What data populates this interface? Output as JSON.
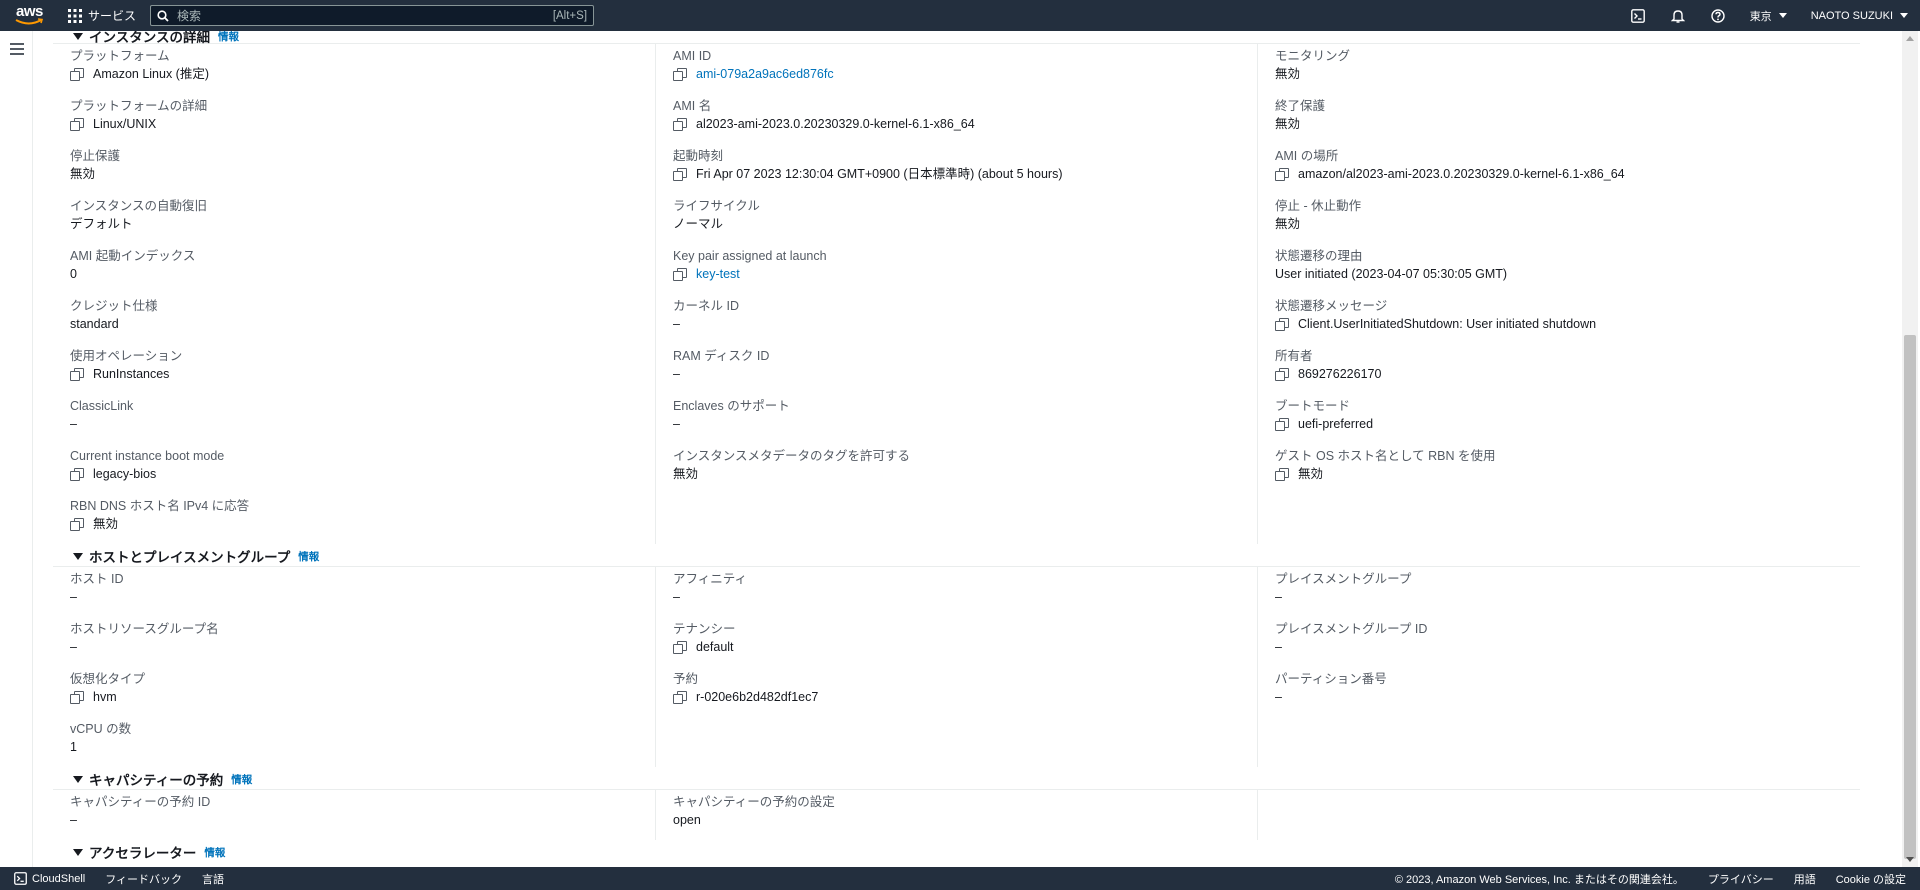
{
  "topbar": {
    "logo_text": "aws",
    "services_label": "サービス",
    "search_placeholder": "検索",
    "search_shortcut": "[Alt+S]",
    "region": "東京",
    "user": "NAOTO SUZUKI"
  },
  "sections": {
    "details": {
      "title": "インスタンスの詳細",
      "info": "情報",
      "col1": [
        {
          "label": "プラットフォーム",
          "value": "Amazon Linux (推定)"
        },
        {
          "label": "プラットフォームの詳細",
          "value": "Linux/UNIX"
        },
        {
          "label": "停止保護",
          "value": "無効"
        },
        {
          "label": "インスタンスの自動復旧",
          "value": "デフォルト"
        },
        {
          "label": "AMI 起動インデックス",
          "value": "0"
        },
        {
          "label": "クレジット仕様",
          "value": "standard"
        },
        {
          "label": "使用オペレーション",
          "value": "RunInstances"
        },
        {
          "label": "ClassicLink",
          "value": "–"
        },
        {
          "label": "Current instance boot mode",
          "value": "legacy-bios"
        },
        {
          "label": "RBN DNS ホスト名 IPv4 に応答",
          "value": "無効"
        }
      ],
      "col2": [
        {
          "label": "AMI ID",
          "value": "ami-079a2a9ac6ed876fc"
        },
        {
          "label": "AMI 名",
          "value": "al2023-ami-2023.0.20230329.0-kernel-6.1-x86_64"
        },
        {
          "label": "起動時刻",
          "value": "Fri Apr 07 2023 12:30:04 GMT+0900 (日本標準時) (about 5 hours)"
        },
        {
          "label": "ライフサイクル",
          "value": "ノーマル"
        },
        {
          "label": "Key pair assigned at launch",
          "value": "key-test"
        },
        {
          "label": "カーネル ID",
          "value": "–"
        },
        {
          "label": "RAM ディスク ID",
          "value": "–"
        },
        {
          "label": "Enclaves のサポート",
          "value": "–"
        },
        {
          "label": "インスタンスメタデータのタグを許可する",
          "value": "無効"
        }
      ],
      "col3": [
        {
          "label": "モニタリング",
          "value": "無効"
        },
        {
          "label": "終了保護",
          "value": "無効"
        },
        {
          "label": "AMI の場所",
          "value": "amazon/al2023-ami-2023.0.20230329.0-kernel-6.1-x86_64"
        },
        {
          "label": "停止 - 休止動作",
          "value": "無効"
        },
        {
          "label": "状態遷移の理由",
          "value": "User initiated (2023-04-07 05:30:05 GMT)"
        },
        {
          "label": "状態遷移メッセージ",
          "value": "Client.UserInitiatedShutdown: User initiated shutdown"
        },
        {
          "label": "所有者",
          "value": "869276226170"
        },
        {
          "label": "ブートモード",
          "value": "uefi-preferred"
        },
        {
          "label": "ゲスト OS ホスト名として RBN を使用",
          "value": "無効"
        }
      ]
    },
    "host": {
      "title": "ホストとプレイスメントグループ",
      "info": "情報",
      "col1": [
        {
          "label": "ホスト ID",
          "value": "–"
        },
        {
          "label": "ホストリソースグループ名",
          "value": "–"
        },
        {
          "label": "仮想化タイプ",
          "value": "hvm"
        },
        {
          "label": "vCPU の数",
          "value": "1"
        }
      ],
      "col2": [
        {
          "label": "アフィニティ",
          "value": "–"
        },
        {
          "label": "テナンシー",
          "value": "default"
        },
        {
          "label": "予約",
          "value": "r-020e6b2d482df1ec7"
        }
      ],
      "col3": [
        {
          "label": "プレイスメントグループ",
          "value": "–"
        },
        {
          "label": "プレイスメントグループ ID",
          "value": "–"
        },
        {
          "label": "パーティション番号",
          "value": "–"
        }
      ]
    },
    "capacity": {
      "title": "キャパシティーの予約",
      "info": "情報",
      "col1": [
        {
          "label": "キャパシティーの予約 ID",
          "value": "–"
        }
      ],
      "col2": [
        {
          "label": "キャパシティーの予約の設定",
          "value": "open"
        }
      ]
    },
    "accelerator": {
      "title": "アクセラレーター",
      "info": "情報"
    }
  },
  "footer": {
    "cloudshell": "CloudShell",
    "feedback": "フィードバック",
    "language": "言語",
    "copyright": "© 2023, Amazon Web Services, Inc. またはその関連会社。",
    "privacy": "プライバシー",
    "terms": "用語",
    "cookie": "Cookie の設定"
  }
}
